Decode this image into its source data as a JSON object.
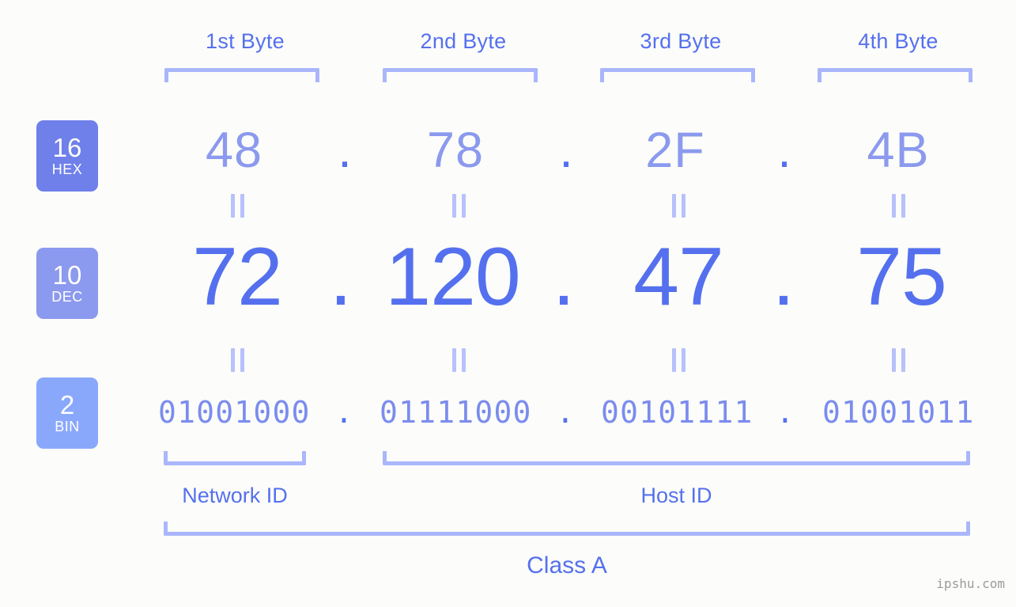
{
  "meta": {
    "background_color": "#fcfdfa",
    "accent_color": "#5570ee",
    "bracket_color": "#aab6fb",
    "watermark": "ipshu.com"
  },
  "byte_headers": [
    {
      "label": "1st Byte"
    },
    {
      "label": "2nd Byte"
    },
    {
      "label": "3rd Byte"
    },
    {
      "label": "4th Byte"
    }
  ],
  "bases": [
    {
      "num": "16",
      "name": "HEX",
      "color": "#6f80ea"
    },
    {
      "num": "10",
      "name": "DEC",
      "color": "#8b99ee"
    },
    {
      "num": "2",
      "name": "BIN",
      "color": "#8aa8fb"
    }
  ],
  "rows": {
    "hex": {
      "base_num": "16",
      "base_name": "HEX",
      "values": [
        "48",
        "78",
        "2F",
        "4B"
      ],
      "separator": "."
    },
    "dec": {
      "base_num": "10",
      "base_name": "DEC",
      "values": [
        "72",
        "120",
        "47",
        "75"
      ],
      "separator": "."
    },
    "bin": {
      "base_num": "2",
      "base_name": "BIN",
      "values": [
        "01001000",
        "01111000",
        "00101111",
        "01001011"
      ],
      "separator": "."
    }
  },
  "equals_marks": {
    "symbol": "=",
    "count_per_row": 4
  },
  "regions": [
    {
      "label": "Network ID"
    },
    {
      "label": "Host ID"
    }
  ],
  "class": {
    "label": "Class A"
  }
}
